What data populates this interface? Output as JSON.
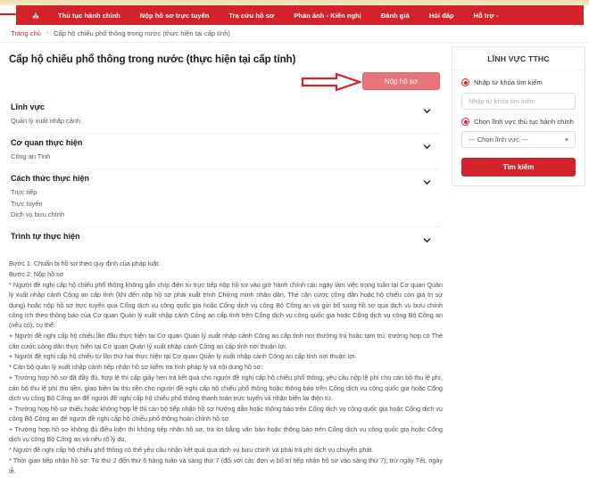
{
  "theme": {
    "brand_red": "#d2232a",
    "button_pink": "#e8737b",
    "top_strip": "#f5e3b3",
    "text_dark": "#1a1a1a",
    "text_body": "#4a4a4a"
  },
  "nav": {
    "home_icon": "home-icon",
    "items": [
      {
        "label": "Thủ tục hành chính"
      },
      {
        "label": "Nộp hồ sơ trực tuyến"
      },
      {
        "label": "Tra cứu hồ sơ"
      },
      {
        "label": "Phản ánh - Kiến nghị"
      },
      {
        "label": "Đánh giá"
      },
      {
        "label": "Hỏi đáp"
      },
      {
        "label": "Hỗ trợ"
      }
    ],
    "support_caret": "-"
  },
  "breadcrumb": {
    "home": "Trang chủ",
    "separator": ">",
    "current": "Cấp hộ chiếu phổ thông trong nước (thực hiện tại cấp tỉnh)"
  },
  "page": {
    "title": "Cấp hộ chiếu phổ thông trong nước (thực hiện tại cấp tỉnh)",
    "submit_label": "Nộp hồ sơ",
    "annotation_icon": "right-arrow-annotation"
  },
  "accordion": [
    {
      "title": "Lĩnh vực",
      "chevron": "chevron-down-icon",
      "lines": [
        "Quản lý xuất nhập cảnh"
      ]
    },
    {
      "title": "Cơ quan thực hiện",
      "chevron": "chevron-down-icon",
      "lines": [
        "Công an Tỉnh"
      ]
    },
    {
      "title": "Cách thức thực hiện",
      "chevron": "chevron-down-icon",
      "lines": [
        "Trực tiếp",
        "Trực tuyến",
        "Dịch vụ bưu chính"
      ]
    },
    {
      "title": "Trình tự thực hiện",
      "chevron": "chevron-down-icon",
      "lines": []
    }
  ],
  "procedure": {
    "paragraphs": [
      "Bước 1: Chuẩn bị hồ sơ theo quy định của pháp luật.",
      "Bước 2: Nộp hồ sơ",
      "* Người đề nghị cấp hộ chiếu phổ thông không gắn chíp điện tử trực tiếp nộp hồ sơ vào giờ hành chính các ngày làm việc trong tuần tại Cơ quan Quản lý xuất nhập cảnh Công an cấp tỉnh (khi đến nộp hồ sơ phải xuất trình Chứng minh nhân dân, Thẻ căn cước công dân hoặc hộ chiếu còn giá trị sử dụng) hoặc nộp hồ sơ trực tuyến qua Cổng dịch vụ công quốc gia hoặc Cổng dịch vụ công Bộ Công an và gửi bổ sung hồ sơ qua dịch vụ bưu chính công ích theo thông báo của Cơ quan Quản lý xuất nhập cảnh Công an cấp tỉnh trên Cổng dịch vụ công quốc gia hoặc Cổng dịch vụ công Bộ Công an (nếu có), cụ thể:",
      "+ Người đề nghị cấp hộ chiếu lần đầu thực hiện tại Cơ quan Quản lý xuất nhập cảnh Công an cấp tỉnh nơi thường trú hoặc tạm trú; trường hợp có Thẻ căn cước công dân thực hiện tại Cơ quan Quản lý xuất nhập cảnh Công an cấp tỉnh nơi thuận lợi.",
      "+ Người đề nghị cấp hộ chiếu từ lần thứ hai thực hiện tại Cơ quan Quản lý xuất nhập cảnh Công an cấp tỉnh nơi thuận lợi.",
      "* Cán bộ quản lý xuất nhập cảnh tiếp nhận hồ sơ kiểm tra tính pháp lý và nội dung hồ sơ:",
      "+ Trường hợp hồ sơ đã đầy đủ, hợp lệ thì cấp giấy hẹn trả kết quả cho người đề nghị cấp hộ chiếu phổ thông; yêu cầu nộp lệ phí cho cán bộ thu lệ phí, cán bộ thu lệ phí thu tiền, giao biên lai thu tiền cho người đề nghị cấp hộ chiếu phổ thông hoặc thông báo trên Cổng dịch vụ công quốc gia hoặc Cổng dịch vụ công Bộ Công an để người đề nghị cấp hộ chiếu phổ thông thanh toán trực tuyến và nhận biên lai điện tử.",
      "+ Trường hợp hồ sơ thiếu hoặc không hợp lệ thì cán bộ tiếp nhận hồ sơ hướng dẫn hoặc thông báo trên Cổng dịch vụ công quốc gia hoặc Cổng dịch vụ công Bộ Công an để người đề nghị cấp hộ chiếu phổ thông hoàn chỉnh hồ sơ.",
      "+ Trường hợp hồ sơ không đủ điều kiện thì không tiếp nhận hồ sơ, trả lời bằng văn bản hoặc thông báo trên Cổng dịch vụ công quốc gia hoặc Cổng dịch vụ công Bộ Công an và nêu rõ lý do.",
      "* Người đề nghị cấp hộ chiếu phổ thông có thể yêu cầu nhận kết quả qua dịch vụ bưu chính và phải trả phí dịch vụ chuyển phát.",
      "* Thời gian tiếp nhận hồ sơ: Từ thứ 2 đến thứ 6 hàng tuần và sáng thứ 7 (đối với các đơn vị bố trí tiếp nhận hồ sơ vào sáng thứ 7); trừ ngày Tết, ngày lễ."
    ]
  },
  "sidebar": {
    "heading": "LĨNH VỰC TTHC",
    "option_keyword_label": "Nhập từ khóa tìm kiếm",
    "keyword_placeholder": "Nhập từ khóa tìm kiếm",
    "keyword_value": "",
    "option_field_label": "Chọn lĩnh vực thủ tục hành chính",
    "select_value": "--- Chọn lĩnh vực ---",
    "select_caret": "chevron-down-icon",
    "search_button": "Tìm kiếm"
  }
}
